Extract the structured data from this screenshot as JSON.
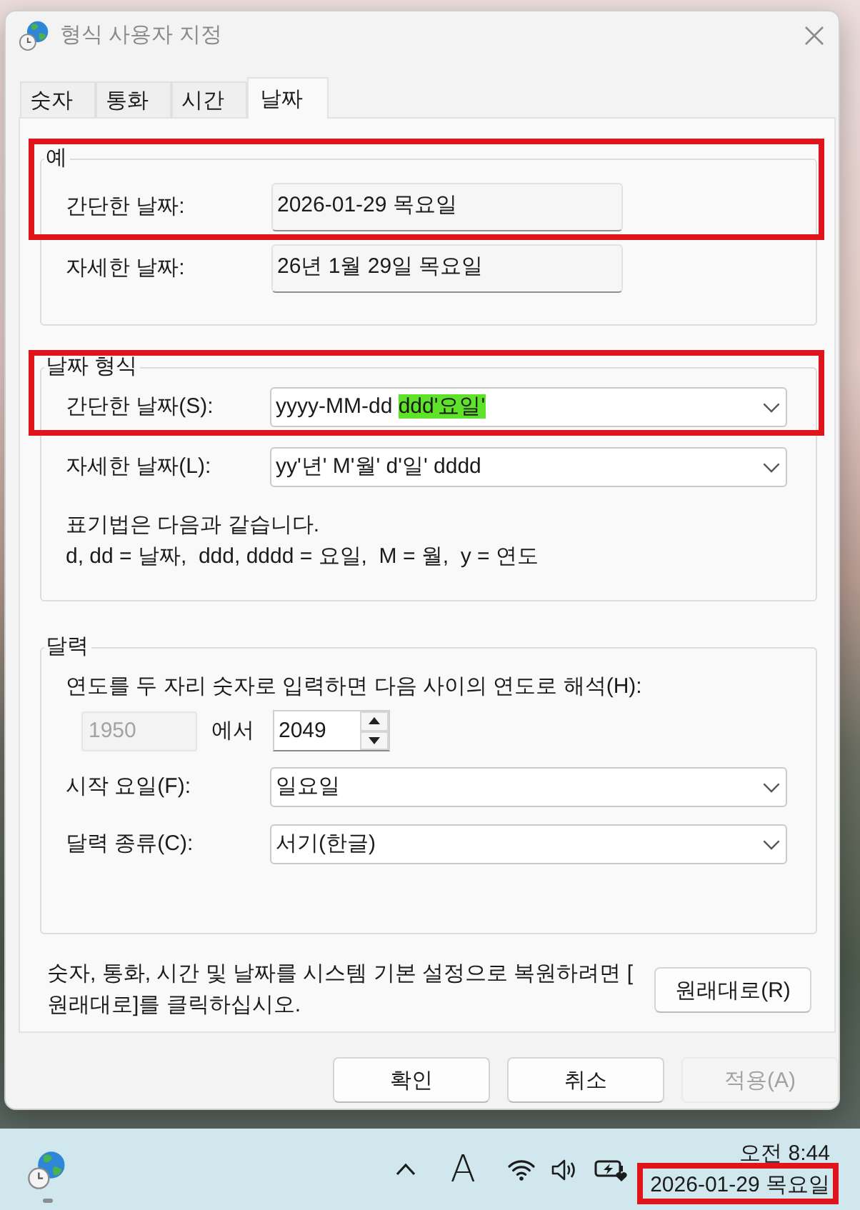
{
  "window": {
    "title": "형식 사용자 지정"
  },
  "tabs": [
    {
      "label": "숫자",
      "selected": false
    },
    {
      "label": "통화",
      "selected": false
    },
    {
      "label": "시간",
      "selected": false
    },
    {
      "label": "날짜",
      "selected": true
    }
  ],
  "example": {
    "title": "예",
    "framed": true,
    "rows": [
      {
        "label": "간단한 날짜:",
        "value": "2026-01-29 목요일"
      },
      {
        "label": "자세한 날짜:",
        "value": "26년 1월 29일 목요일"
      }
    ]
  },
  "date_format": {
    "title": "날짜 형식",
    "framed": true,
    "rows": [
      {
        "label": "간단한 날짜(S):",
        "value": [
          {
            "text": "yyyy-MM-dd ",
            "marked": false
          },
          {
            "text": "ddd'요일'",
            "marked": true
          }
        ]
      },
      {
        "label": "자세한 날짜(L):",
        "value": [
          {
            "text": "yy'년' M'월' d'일' dddd",
            "marked": false
          }
        ]
      }
    ],
    "notation": [
      "표기법은 다음과 같습니다.",
      "d, dd = 날짜,  ddd, dddd = 요일,  M = 월,  y = 연도"
    ]
  },
  "calendar": {
    "title": "달력",
    "two_digit_year": {
      "label": "연도를 두 자리 숫자로 입력하면 다음 사이의 연도로 해석(H):",
      "from": {
        "value": "1950",
        "disabled": true
      },
      "between": "에서",
      "to": {
        "value": "2049",
        "disabled": false
      }
    },
    "rows": [
      {
        "label": "시작 요일(F):",
        "value": "일요일"
      },
      {
        "label": "달력 종류(C):",
        "value": "서기(한글)"
      }
    ]
  },
  "restore": {
    "lines": [
      "숫자, 통화, 시간 및 날짜를 시스템 기본 설정으로 복원하려면 [",
      "원래대로]를 클릭하십시오."
    ],
    "button": "원래대로(R)"
  },
  "buttons": [
    {
      "label": "확인",
      "disabled": false
    },
    {
      "label": "취소",
      "disabled": false
    },
    {
      "label": "적용(A)",
      "disabled": true
    }
  ],
  "taskbar": {
    "apps": [
      {
        "running": true
      }
    ],
    "input_mode": "A",
    "time": "오전 8:44",
    "date": "2026-01-29 목요일",
    "date_framed": true
  }
}
